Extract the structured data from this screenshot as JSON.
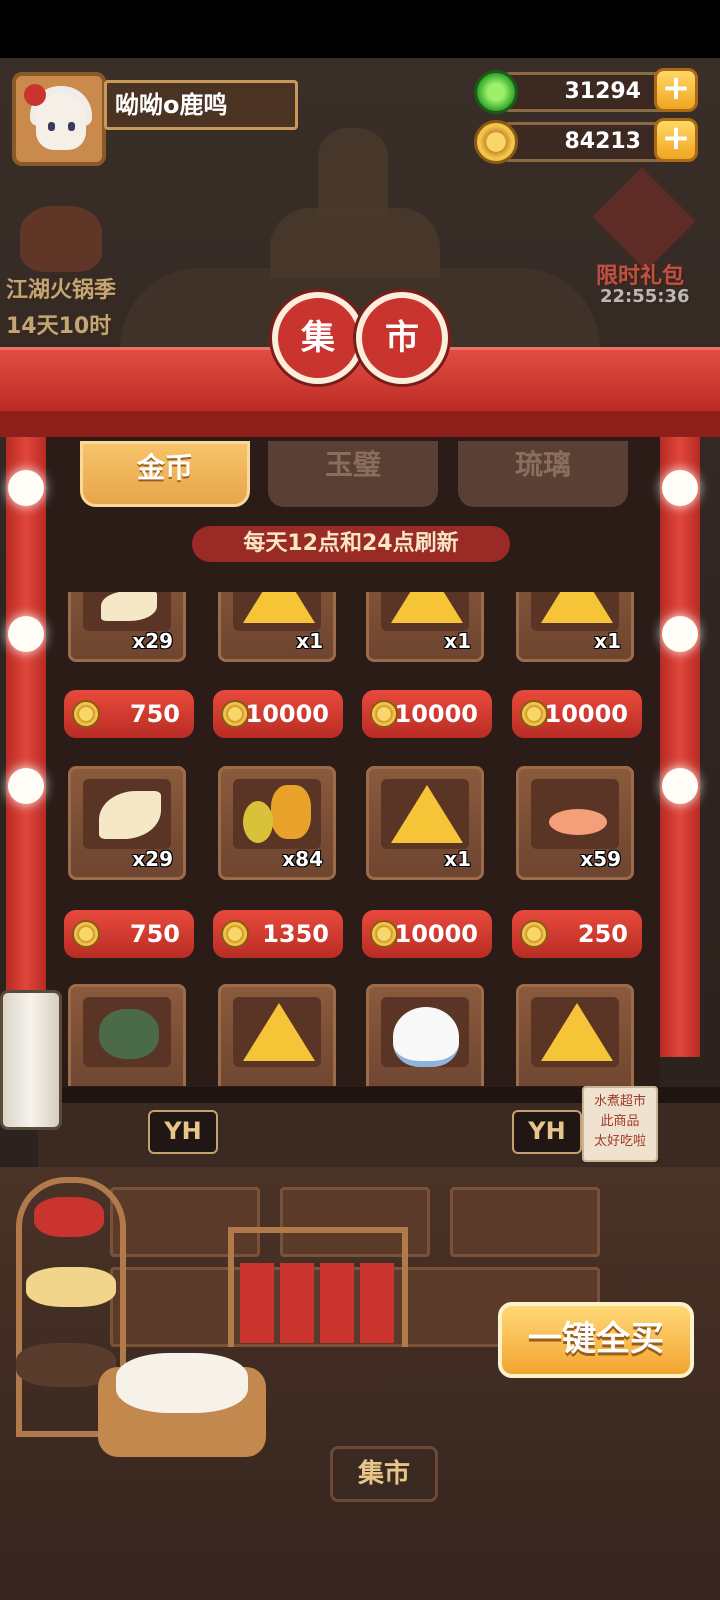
{
  "player": {
    "name": "呦呦o鹿鸣"
  },
  "currency": {
    "jade": {
      "amount": "31294",
      "icon": "jade-coin-icon"
    },
    "gold": {
      "amount": "84213",
      "icon": "gold-coin-icon"
    }
  },
  "events": {
    "left_title": "江湖火锅季",
    "left_timer": "14天10时",
    "right_title": "限时礼包",
    "right_timer": "22:55:36"
  },
  "market": {
    "sign_chars": [
      "集",
      "市"
    ],
    "tabs": [
      {
        "label": "金币",
        "active": true
      },
      {
        "label": "玉璧",
        "active": false
      },
      {
        "label": "琉璃",
        "active": false
      }
    ],
    "refresh_text": "每天12点和24点刷新",
    "rows": [
      {
        "items": [
          {
            "name": "bamboo-shoot",
            "qty": "x29",
            "price": "750"
          },
          {
            "name": "star-tofu",
            "qty": "x1",
            "price": "10000"
          },
          {
            "name": "star-tofu",
            "qty": "x1",
            "price": "10000"
          },
          {
            "name": "star-tofu",
            "qty": "x1",
            "price": "10000"
          }
        ]
      },
      {
        "items": [
          {
            "name": "bamboo-shoot",
            "qty": "x29",
            "price": "750"
          },
          {
            "name": "fruit-basket",
            "qty": "x84",
            "price": "1350"
          },
          {
            "name": "coral-tofu",
            "qty": "x1",
            "price": "10000"
          },
          {
            "name": "shrimp-meat",
            "qty": "x59",
            "price": "250"
          }
        ]
      },
      {
        "items": [
          {
            "name": "crab"
          },
          {
            "name": "star-tofu"
          },
          {
            "name": "rice-bowl"
          },
          {
            "name": "star-tofu"
          }
        ]
      }
    ],
    "buy_all_label": "一键全买",
    "stall_sign": "YH",
    "note_lines": [
      "水煮超市",
      "此商品",
      "太好吃啦"
    ],
    "bottom_tag": "集市"
  },
  "colors": {
    "accent_red": "#c9342e",
    "gold": "#f6c437",
    "wood": "#6e4530"
  }
}
